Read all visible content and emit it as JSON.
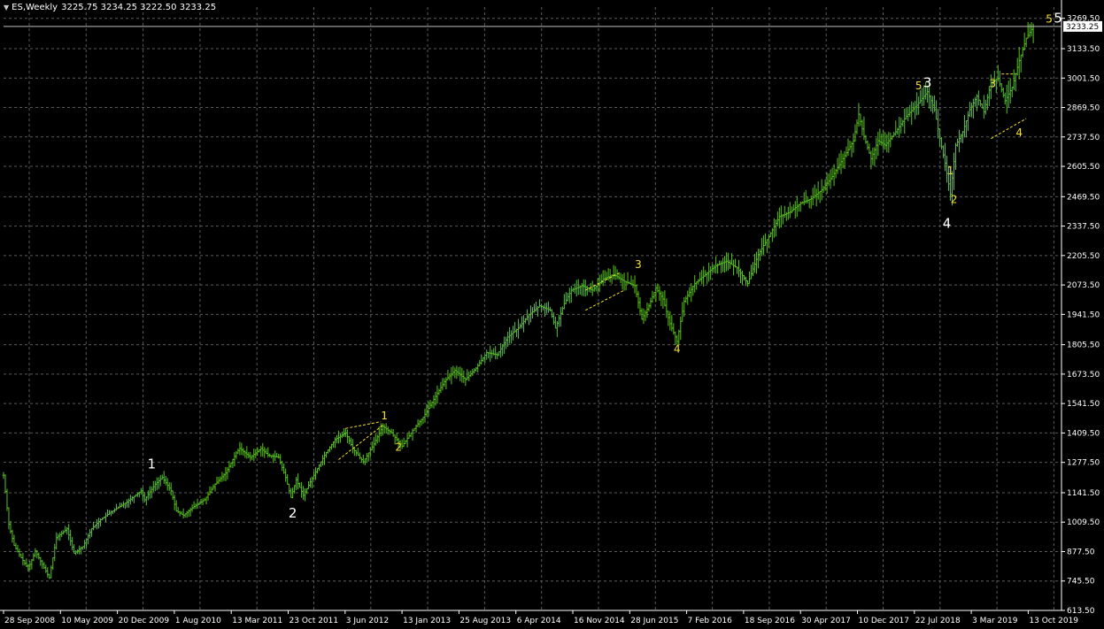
{
  "header": {
    "symbol": "ES,Weekly",
    "ohlc": "3225.75 3234.25 3222.50 3233.25"
  },
  "colors": {
    "background": "#000000",
    "grid": "#5a5a5a",
    "axis_text": "#ffffff",
    "bars": "#58c31f",
    "wave_minor": "#f5e12b",
    "wave_major": "#ffffff",
    "price_line": "#c0c0c0"
  },
  "chart_data": {
    "type": "ohlc_bar",
    "timeframe": "Weekly",
    "current_price": "3233.25",
    "ylim": [
      613.5,
      3320
    ],
    "y_ticks": [
      "613.50",
      "745.50",
      "877.50",
      "1009.50",
      "1141.50",
      "1277.50",
      "1409.50",
      "1541.50",
      "1673.50",
      "1805.50",
      "1941.50",
      "2073.50",
      "2205.50",
      "2337.50",
      "2469.50",
      "2605.50",
      "2737.50",
      "2869.50",
      "3001.50",
      "3133.50",
      "3269.50"
    ],
    "x_ticks": [
      "28 Sep 2008",
      "10 May 2009",
      "20 Dec 2009",
      "1 Aug 2010",
      "13 Mar 2011",
      "23 Oct 2011",
      "3 Jun 2012",
      "13 Jan 2013",
      "25 Aug 2013",
      "6 Apr 2014",
      "16 Nov 2014",
      "28 Jun 2015",
      "7 Feb 2016",
      "18 Sep 2016",
      "30 Apr 2017",
      "10 Dec 2017",
      "22 Jul 2018",
      "3 Mar 2019",
      "13 Oct 2019"
    ],
    "x_range_weeks": [
      0,
      584
    ],
    "price_path": [
      [
        0,
        1220
      ],
      [
        3,
        1000
      ],
      [
        6,
        905
      ],
      [
        10,
        850
      ],
      [
        14,
        800
      ],
      [
        18,
        880
      ],
      [
        22,
        820
      ],
      [
        26,
        760
      ],
      [
        30,
        940
      ],
      [
        36,
        980
      ],
      [
        40,
        870
      ],
      [
        45,
        900
      ],
      [
        50,
        980
      ],
      [
        55,
        1020
      ],
      [
        60,
        1050
      ],
      [
        70,
        1100
      ],
      [
        78,
        1150
      ],
      [
        80,
        1110
      ],
      [
        86,
        1180
      ],
      [
        90,
        1210
      ],
      [
        95,
        1150
      ],
      [
        98,
        1060
      ],
      [
        102,
        1040
      ],
      [
        108,
        1080
      ],
      [
        114,
        1110
      ],
      [
        120,
        1180
      ],
      [
        126,
        1230
      ],
      [
        132,
        1320
      ],
      [
        134,
        1340
      ],
      [
        140,
        1300
      ],
      [
        146,
        1340
      ],
      [
        150,
        1310
      ],
      [
        156,
        1300
      ],
      [
        160,
        1210
      ],
      [
        163,
        1120
      ],
      [
        166,
        1200
      ],
      [
        170,
        1130
      ],
      [
        176,
        1220
      ],
      [
        182,
        1310
      ],
      [
        188,
        1380
      ],
      [
        194,
        1410
      ],
      [
        198,
        1340
      ],
      [
        204,
        1280
      ],
      [
        210,
        1360
      ],
      [
        215,
        1440
      ],
      [
        220,
        1410
      ],
      [
        226,
        1350
      ],
      [
        232,
        1420
      ],
      [
        238,
        1480
      ],
      [
        244,
        1560
      ],
      [
        250,
        1640
      ],
      [
        256,
        1690
      ],
      [
        262,
        1650
      ],
      [
        268,
        1700
      ],
      [
        274,
        1770
      ],
      [
        280,
        1760
      ],
      [
        286,
        1840
      ],
      [
        292,
        1880
      ],
      [
        298,
        1940
      ],
      [
        304,
        1980
      ],
      [
        310,
        1960
      ],
      [
        313,
        1880
      ],
      [
        318,
        1990
      ],
      [
        322,
        2050
      ],
      [
        328,
        2070
      ],
      [
        334,
        2050
      ],
      [
        340,
        2100
      ],
      [
        346,
        2120
      ],
      [
        352,
        2090
      ],
      [
        358,
        2070
      ],
      [
        362,
        1920
      ],
      [
        366,
        1980
      ],
      [
        370,
        2060
      ],
      [
        374,
        2010
      ],
      [
        378,
        1900
      ],
      [
        382,
        1820
      ],
      [
        386,
        2000
      ],
      [
        392,
        2080
      ],
      [
        398,
        2120
      ],
      [
        404,
        2160
      ],
      [
        410,
        2180
      ],
      [
        416,
        2150
      ],
      [
        422,
        2080
      ],
      [
        428,
        2210
      ],
      [
        434,
        2290
      ],
      [
        440,
        2380
      ],
      [
        446,
        2400
      ],
      [
        452,
        2440
      ],
      [
        458,
        2460
      ],
      [
        464,
        2500
      ],
      [
        470,
        2560
      ],
      [
        476,
        2640
      ],
      [
        482,
        2720
      ],
      [
        485,
        2840
      ],
      [
        488,
        2740
      ],
      [
        492,
        2640
      ],
      [
        496,
        2720
      ],
      [
        500,
        2700
      ],
      [
        506,
        2760
      ],
      [
        512,
        2830
      ],
      [
        518,
        2880
      ],
      [
        524,
        2940
      ],
      [
        528,
        2860
      ],
      [
        531,
        2730
      ],
      [
        534,
        2620
      ],
      [
        537,
        2480
      ],
      [
        540,
        2700
      ],
      [
        544,
        2760
      ],
      [
        548,
        2860
      ],
      [
        552,
        2920
      ],
      [
        556,
        2850
      ],
      [
        560,
        2980
      ],
      [
        564,
        3000
      ],
      [
        568,
        2900
      ],
      [
        572,
        2960
      ],
      [
        576,
        3080
      ],
      [
        580,
        3180
      ],
      [
        584,
        3233
      ]
    ],
    "wave_labels": [
      {
        "text": "1",
        "color": "white",
        "week": 84,
        "price": 1250
      },
      {
        "text": "2",
        "color": "white",
        "week": 164,
        "price": 1030
      },
      {
        "text": "1",
        "color": "yellow",
        "week": 216,
        "price": 1470
      },
      {
        "text": "2",
        "color": "yellow",
        "week": 224,
        "price": 1330
      },
      {
        "text": "3",
        "color": "yellow",
        "week": 360,
        "price": 2150
      },
      {
        "text": "4",
        "color": "yellow",
        "week": 382,
        "price": 1770
      },
      {
        "text": "5",
        "color": "yellow",
        "week": 519,
        "price": 2950
      },
      {
        "text": "3",
        "color": "white",
        "week": 524,
        "price": 2960
      },
      {
        "text": "1",
        "color": "yellow",
        "week": 537,
        "price": 2570
      },
      {
        "text": "2",
        "color": "yellow",
        "week": 539,
        "price": 2440
      },
      {
        "text": "4",
        "color": "white",
        "week": 535,
        "price": 2330
      },
      {
        "text": "3",
        "color": "yellow",
        "week": 561,
        "price": 2960
      },
      {
        "text": "4",
        "color": "yellow",
        "week": 576,
        "price": 2740
      },
      {
        "text": "5",
        "color": "yellow",
        "week": 593,
        "price": 3250
      },
      {
        "text": "5",
        "color": "white",
        "week": 598,
        "price": 3250
      }
    ],
    "dashed_lines": [
      {
        "week1": 190,
        "price1": 1290,
        "week2": 216,
        "price2": 1450
      },
      {
        "week1": 194,
        "price1": 1430,
        "week2": 214,
        "price2": 1460
      },
      {
        "week1": 330,
        "price1": 2050,
        "week2": 350,
        "price2": 2130
      },
      {
        "week1": 330,
        "price1": 1960,
        "week2": 352,
        "price2": 2050
      },
      {
        "week1": 560,
        "price1": 2730,
        "week2": 580,
        "price2": 2820
      },
      {
        "week1": 566,
        "price1": 3020,
        "week2": 574,
        "price2": 3020
      }
    ]
  }
}
